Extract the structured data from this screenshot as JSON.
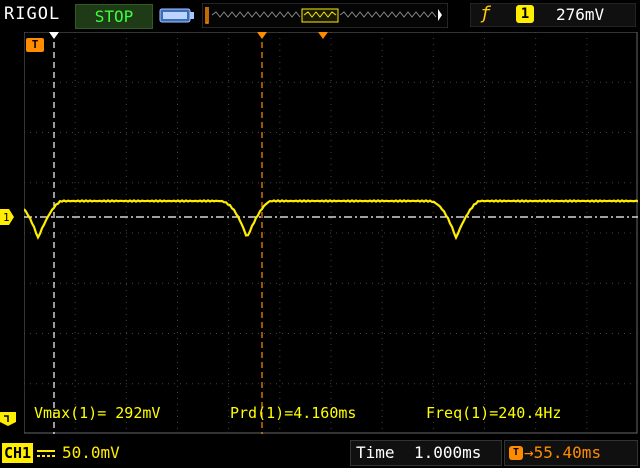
{
  "header": {
    "brand": "RIGOL",
    "run_status": "STOP",
    "trigger": {
      "edge_icon": "rising-edge-icon",
      "channel": "1",
      "level": "276mV"
    }
  },
  "screen": {
    "trigger_position_marker": "T",
    "channel_marker": "channel-1-ground-marker"
  },
  "measurements": [
    {
      "label": "Vmax(1)",
      "value": "= 292mV"
    },
    {
      "label": "Prd(1)",
      "value": "=4.160ms"
    },
    {
      "label": "Freq(1)",
      "value": "=240.4Hz"
    }
  ],
  "footer": {
    "channel_label": "CH1",
    "channel_scale": "50.0mV",
    "time_label": "Time",
    "time_scale": "1.000ms",
    "offset_label": "55.40ms"
  },
  "colors": {
    "ch1": "#ffee00",
    "trigger": "#ff8c00",
    "status_bg": "#1f3a16",
    "status_text": "#3cff3c"
  }
}
